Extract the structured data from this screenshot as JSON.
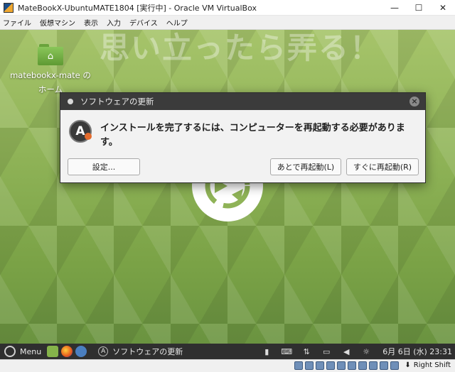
{
  "window": {
    "title": "MateBookX-UbuntuMATE1804 [実行中] - Oracle VM VirtualBox",
    "controls": [
      "—",
      "☐",
      "✕"
    ]
  },
  "menubar": [
    "ファイル",
    "仮想マシン",
    "表示",
    "入力",
    "デバイス",
    "ヘルプ"
  ],
  "desktop": {
    "watermark": "思い立ったら弄る！",
    "home_icon_label_1": "matebookx-mate の",
    "home_icon_label_2": "ホーム"
  },
  "dialog": {
    "title": "ソフトウェアの更新",
    "message": "インストールを完了するには、コンピューターを再起動する必要があります。",
    "buttons": {
      "settings": "設定...",
      "restart_later": "あとで再起動(L)",
      "restart_now": "すぐに再起動(R)"
    }
  },
  "panel": {
    "menu_label": "Menu",
    "task_label": "ソフトウェアの更新",
    "clock": "6月 6日 (水) 23:31"
  },
  "statusbar": {
    "host_key": "Right Shift"
  },
  "colors": {
    "desktop_green": "#8fb357",
    "dialog_title_bg": "#3b3b3b",
    "panel_bg": "#2f2f2f"
  }
}
